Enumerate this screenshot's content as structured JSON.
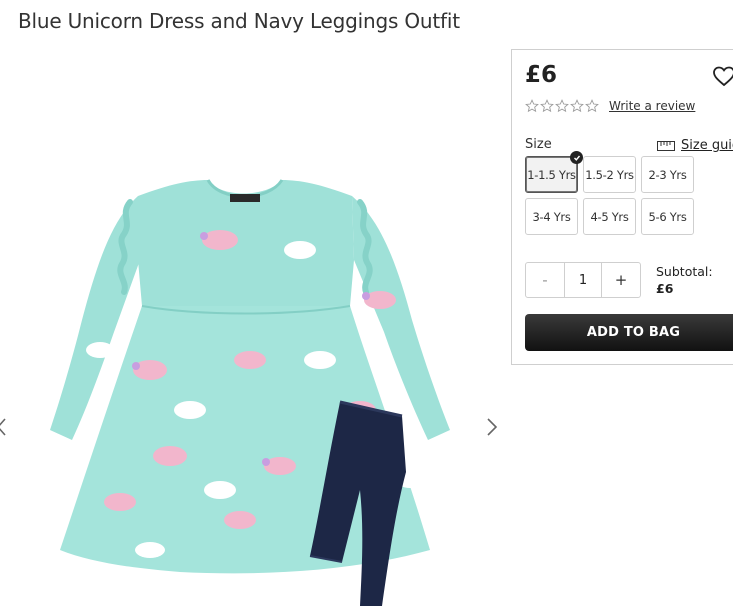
{
  "product": {
    "title": "Blue Unicorn Dress and Navy Leggings Outfit",
    "price": "£6",
    "review_link": "Write a review",
    "rating_stars": 0,
    "rating_max": 5
  },
  "sizes": {
    "label": "Size",
    "guide_label": "Size guide",
    "options": [
      "1-1.5 Yrs",
      "1.5-2 Yrs",
      "2-3 Yrs",
      "3-4 Yrs",
      "4-5 Yrs",
      "5-6 Yrs"
    ],
    "selected": "1-1.5 Yrs"
  },
  "quantity": {
    "minus": "-",
    "value": "1",
    "plus": "+"
  },
  "subtotal": {
    "label": "Subtotal:",
    "value": "£6"
  },
  "cart": {
    "add_label": "ADD TO BAG"
  },
  "colors": {
    "dress": "#9fe1d8",
    "leggings": "#1d2746",
    "button": "#1a1a1a"
  }
}
